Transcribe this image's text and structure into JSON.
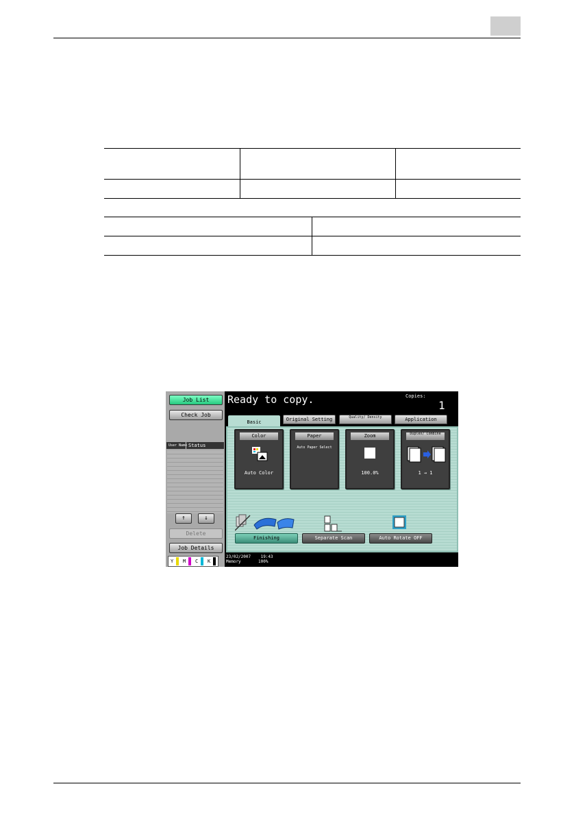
{
  "screen": {
    "status_title": "Ready to copy.",
    "copies_label": "Copies:",
    "copies_value": "1",
    "left": {
      "job_list": "Job List",
      "check_job": "Check Job",
      "col_user_name": "User Name",
      "col_status": "Status",
      "up_arrow": "↑",
      "down_arrow": "↓",
      "delete": "Delete",
      "job_details": "Job Details",
      "toner": [
        "Y",
        "M",
        "C",
        "K"
      ]
    },
    "tabs": [
      "Basic",
      "Original Setting",
      "Quality/ Density",
      "Application"
    ],
    "functions": {
      "color": {
        "title": "Color",
        "value": "Auto Color"
      },
      "paper": {
        "title": "Paper",
        "value": "Auto Paper Select"
      },
      "zoom": {
        "title": "Zoom",
        "value": "100.0%"
      },
      "duplex": {
        "title": "Duplex/ Combine",
        "value": "1 → 1"
      }
    },
    "bottom_buttons": {
      "finishing": "Finishing",
      "separate_scan": "Separate Scan",
      "auto_rotate": "Auto Rotate OFF"
    },
    "footer": {
      "date": "23/02/2007",
      "time": "19:43",
      "memory_label": "Memory",
      "memory_value": "100%"
    }
  },
  "colors": {
    "accent_green": "#25c87e",
    "panel_teal": "#b7dcd2",
    "chapter_box": "#cfcfcf"
  }
}
